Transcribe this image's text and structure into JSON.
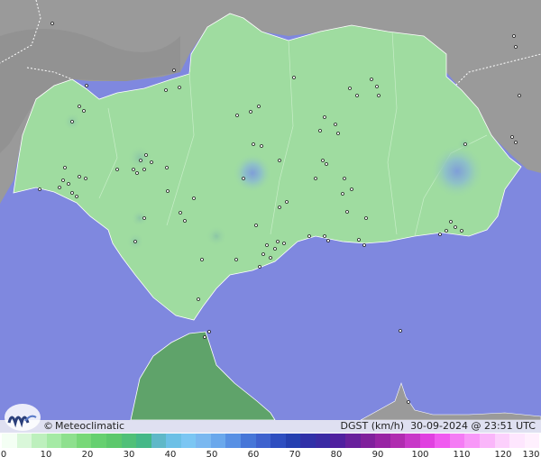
{
  "map": {
    "brand": "Meteoclimatic",
    "copyright_symbol": "©",
    "variable": "DGST (km/h)",
    "timestamp": "30-09-2024 @ 23:51 UTC",
    "colors": {
      "sea": "#7f88df",
      "land_outside": "#9a9a9a",
      "region": "#9fdca0",
      "morocco": "#5fa36a"
    }
  },
  "scale": {
    "ticks": [
      "0",
      "10",
      "20",
      "30",
      "40",
      "50",
      "60",
      "70",
      "80",
      "90",
      "100",
      "110",
      "120",
      "130"
    ],
    "colors": [
      "#f4fff4",
      "#d9f7d9",
      "#bdf0bd",
      "#a5eaa5",
      "#8ee08e",
      "#78d878",
      "#66d070",
      "#5cc86c",
      "#50c078",
      "#45b888",
      "#5fb8c8",
      "#6cc0e6",
      "#7bc6f3",
      "#7ab8f0",
      "#6aa8ec",
      "#5890e4",
      "#4676d8",
      "#3e62ce",
      "#2e4ec0",
      "#2540b0",
      "#3030a8",
      "#3a2aa4",
      "#50209f",
      "#68209c",
      "#80209c",
      "#9824a4",
      "#b02cb0",
      "#c838c8",
      "#e040e0",
      "#f05af0",
      "#f47cf4",
      "#f898f8",
      "#fab6fa",
      "#fcd0fc",
      "#fee6fe",
      "#fff0fe"
    ]
  }
}
